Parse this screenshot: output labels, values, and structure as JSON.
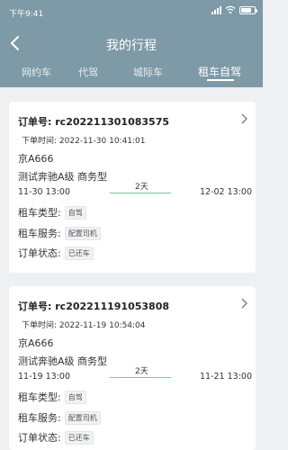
{
  "status": {
    "time": "下午9:41"
  },
  "header": {
    "title": "我的行程",
    "tabs": [
      {
        "label": "网约车"
      },
      {
        "label": "代驾"
      },
      {
        "label": "城际车"
      },
      {
        "label": "租车自驾"
      }
    ],
    "active_tab": 3
  },
  "orders": [
    {
      "order_label": "订单号:",
      "order_no": "rc202211301083575",
      "created_label": "下单时间:",
      "created": "2022-11-30  10:41:01",
      "plate": "京A666",
      "model": "测试奔驰A级 商务型",
      "start": "11-30 13:00",
      "end": "12-02 13:00",
      "duration": "2天",
      "rent_type_label": "租车类型:",
      "rent_type": "自驾",
      "service_label": "租车服务:",
      "service": "配置司机",
      "state_label": "订单状态:",
      "state": "已还车"
    },
    {
      "order_label": "订单号:",
      "order_no": "rc202211191053808",
      "created_label": "下单时间:",
      "created": "2022-11-19  10:54:04",
      "plate": "京A666",
      "model": "测试奔驰A级 商务型",
      "start": "11-19 13:00",
      "end": "11-21 13:00",
      "duration": "2天",
      "rent_type_label": "租车类型:",
      "rent_type": "自驾",
      "service_label": "租车服务:",
      "service": "配置司机",
      "state_label": "订单状态:",
      "state": "已还车"
    }
  ],
  "colors": {
    "header_bg": "#7d9aa6",
    "duration_line": "#7cc99a"
  }
}
